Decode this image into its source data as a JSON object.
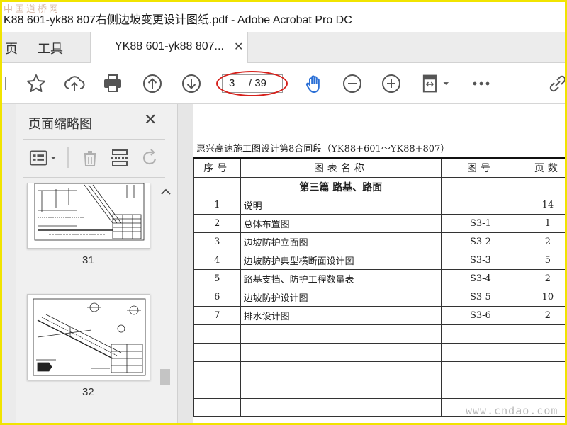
{
  "window": {
    "title": "K88 601-yk88 807右侧边坡变更设计图纸.pdf - Adobe Acrobat Pro DC",
    "watermark_top": "中国道桥网"
  },
  "tabs": {
    "home_partial": "页",
    "tools": "工具",
    "document": "YK88 601-yk88 807..."
  },
  "toolbar": {
    "page_current": "3",
    "page_total": "/ 39",
    "annotation_color": "#d6201b",
    "accent_color": "#2a6fd6"
  },
  "sidebar": {
    "title": "页面缩略图",
    "thumbnails": [
      {
        "page": "31"
      },
      {
        "page": "32"
      }
    ]
  },
  "document": {
    "heading": "惠兴高速施工图设计第8合同段（YK88+601～YK88+807）",
    "columns": [
      "序号",
      "图表名称",
      "图号",
      "页数"
    ],
    "section": "第三篇 路基、路面",
    "rows": [
      {
        "no": "1",
        "name": "说明",
        "code": "",
        "pages": "14"
      },
      {
        "no": "2",
        "name": "总体布置图",
        "code": "S3-1",
        "pages": "1"
      },
      {
        "no": "3",
        "name": "边坡防护立面图",
        "code": "S3-2",
        "pages": "2"
      },
      {
        "no": "4",
        "name": "边坡防护典型横断面设计图",
        "code": "S3-3",
        "pages": "5"
      },
      {
        "no": "5",
        "name": "路基支挡、防护工程数量表",
        "code": "S3-4",
        "pages": "2"
      },
      {
        "no": "6",
        "name": "边坡防护设计图",
        "code": "S3-5",
        "pages": "10"
      },
      {
        "no": "7",
        "name": "排水设计图",
        "code": "S3-6",
        "pages": "2"
      }
    ]
  },
  "watermark_bottom": "www.cndao.com"
}
